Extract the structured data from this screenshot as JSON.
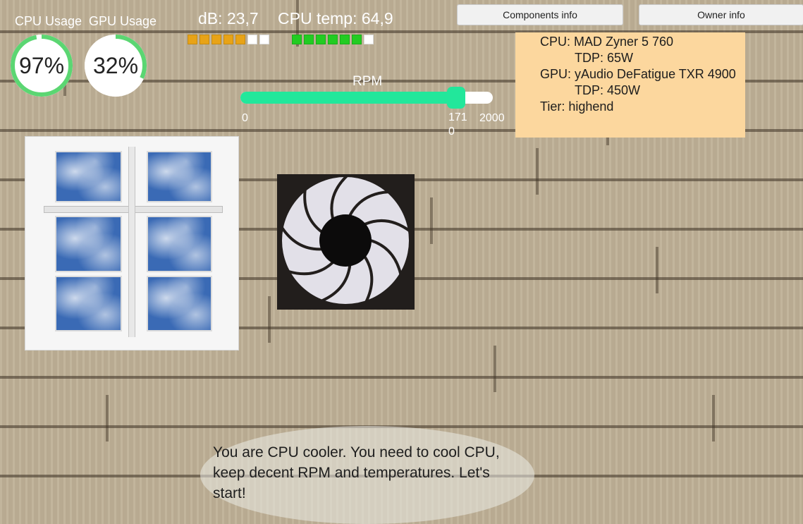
{
  "gauges": {
    "cpu": {
      "label": "CPU Usage",
      "value_text": "97%",
      "fraction": 0.97,
      "color": "#5bd672"
    },
    "gpu": {
      "label": "GPU Usage",
      "value_text": "32%",
      "fraction": 0.32,
      "color": "#5bd672"
    }
  },
  "stats": {
    "db": {
      "label": "dB:",
      "value": "23,7",
      "filled_segments": 5,
      "total_segments": 7,
      "fill_color": "#e8a317"
    },
    "cpu_temp": {
      "label": "CPU temp:",
      "value": "64,9",
      "filled_segments": 6,
      "total_segments": 7,
      "fill_color": "#22cc22"
    }
  },
  "rpm": {
    "label": "RPM",
    "min_label": "0",
    "max_label": "2000",
    "value_label": "1710",
    "min": 0,
    "max": 2000,
    "value": 1710,
    "color": "#22e79b"
  },
  "buttons": {
    "components": "Components info",
    "owner": "Owner info"
  },
  "components_info": {
    "cpu_line": "CPU: MAD Zyner 5 760",
    "cpu_tdp": "TDP: 65W",
    "gpu_line": "GPU: yAudio DeFatigue TXR 4900",
    "gpu_tdp": "TDP: 450W",
    "tier": "Tier: highend"
  },
  "dialog": {
    "text": "You are CPU cooler. You need to cool CPU, keep decent RPM and temperatures. Let's start!"
  }
}
